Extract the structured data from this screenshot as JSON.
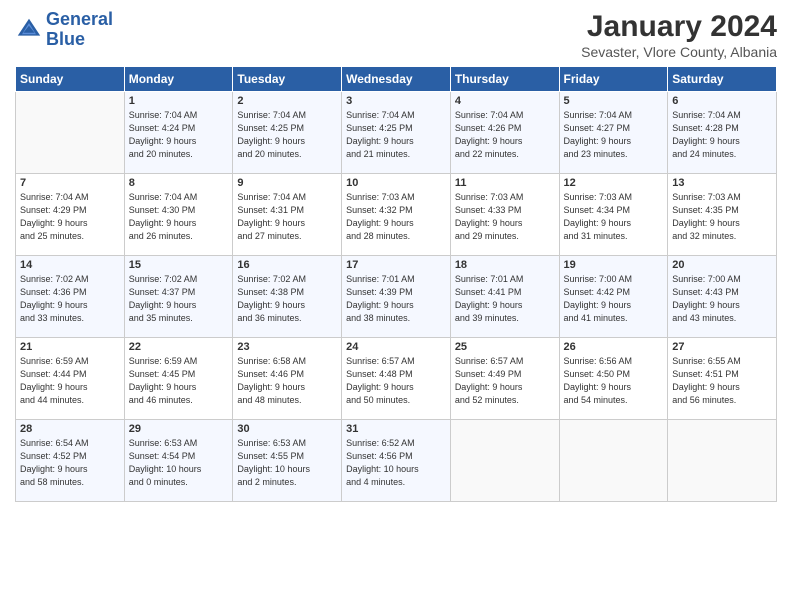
{
  "header": {
    "logo_line1": "General",
    "logo_line2": "Blue",
    "month": "January 2024",
    "location": "Sevaster, Vlore County, Albania"
  },
  "weekdays": [
    "Sunday",
    "Monday",
    "Tuesday",
    "Wednesday",
    "Thursday",
    "Friday",
    "Saturday"
  ],
  "weeks": [
    [
      {
        "day": "",
        "info": ""
      },
      {
        "day": "1",
        "info": "Sunrise: 7:04 AM\nSunset: 4:24 PM\nDaylight: 9 hours\nand 20 minutes."
      },
      {
        "day": "2",
        "info": "Sunrise: 7:04 AM\nSunset: 4:25 PM\nDaylight: 9 hours\nand 20 minutes."
      },
      {
        "day": "3",
        "info": "Sunrise: 7:04 AM\nSunset: 4:25 PM\nDaylight: 9 hours\nand 21 minutes."
      },
      {
        "day": "4",
        "info": "Sunrise: 7:04 AM\nSunset: 4:26 PM\nDaylight: 9 hours\nand 22 minutes."
      },
      {
        "day": "5",
        "info": "Sunrise: 7:04 AM\nSunset: 4:27 PM\nDaylight: 9 hours\nand 23 minutes."
      },
      {
        "day": "6",
        "info": "Sunrise: 7:04 AM\nSunset: 4:28 PM\nDaylight: 9 hours\nand 24 minutes."
      }
    ],
    [
      {
        "day": "7",
        "info": "Sunrise: 7:04 AM\nSunset: 4:29 PM\nDaylight: 9 hours\nand 25 minutes."
      },
      {
        "day": "8",
        "info": "Sunrise: 7:04 AM\nSunset: 4:30 PM\nDaylight: 9 hours\nand 26 minutes."
      },
      {
        "day": "9",
        "info": "Sunrise: 7:04 AM\nSunset: 4:31 PM\nDaylight: 9 hours\nand 27 minutes."
      },
      {
        "day": "10",
        "info": "Sunrise: 7:03 AM\nSunset: 4:32 PM\nDaylight: 9 hours\nand 28 minutes."
      },
      {
        "day": "11",
        "info": "Sunrise: 7:03 AM\nSunset: 4:33 PM\nDaylight: 9 hours\nand 29 minutes."
      },
      {
        "day": "12",
        "info": "Sunrise: 7:03 AM\nSunset: 4:34 PM\nDaylight: 9 hours\nand 31 minutes."
      },
      {
        "day": "13",
        "info": "Sunrise: 7:03 AM\nSunset: 4:35 PM\nDaylight: 9 hours\nand 32 minutes."
      }
    ],
    [
      {
        "day": "14",
        "info": "Sunrise: 7:02 AM\nSunset: 4:36 PM\nDaylight: 9 hours\nand 33 minutes."
      },
      {
        "day": "15",
        "info": "Sunrise: 7:02 AM\nSunset: 4:37 PM\nDaylight: 9 hours\nand 35 minutes."
      },
      {
        "day": "16",
        "info": "Sunrise: 7:02 AM\nSunset: 4:38 PM\nDaylight: 9 hours\nand 36 minutes."
      },
      {
        "day": "17",
        "info": "Sunrise: 7:01 AM\nSunset: 4:39 PM\nDaylight: 9 hours\nand 38 minutes."
      },
      {
        "day": "18",
        "info": "Sunrise: 7:01 AM\nSunset: 4:41 PM\nDaylight: 9 hours\nand 39 minutes."
      },
      {
        "day": "19",
        "info": "Sunrise: 7:00 AM\nSunset: 4:42 PM\nDaylight: 9 hours\nand 41 minutes."
      },
      {
        "day": "20",
        "info": "Sunrise: 7:00 AM\nSunset: 4:43 PM\nDaylight: 9 hours\nand 43 minutes."
      }
    ],
    [
      {
        "day": "21",
        "info": "Sunrise: 6:59 AM\nSunset: 4:44 PM\nDaylight: 9 hours\nand 44 minutes."
      },
      {
        "day": "22",
        "info": "Sunrise: 6:59 AM\nSunset: 4:45 PM\nDaylight: 9 hours\nand 46 minutes."
      },
      {
        "day": "23",
        "info": "Sunrise: 6:58 AM\nSunset: 4:46 PM\nDaylight: 9 hours\nand 48 minutes."
      },
      {
        "day": "24",
        "info": "Sunrise: 6:57 AM\nSunset: 4:48 PM\nDaylight: 9 hours\nand 50 minutes."
      },
      {
        "day": "25",
        "info": "Sunrise: 6:57 AM\nSunset: 4:49 PM\nDaylight: 9 hours\nand 52 minutes."
      },
      {
        "day": "26",
        "info": "Sunrise: 6:56 AM\nSunset: 4:50 PM\nDaylight: 9 hours\nand 54 minutes."
      },
      {
        "day": "27",
        "info": "Sunrise: 6:55 AM\nSunset: 4:51 PM\nDaylight: 9 hours\nand 56 minutes."
      }
    ],
    [
      {
        "day": "28",
        "info": "Sunrise: 6:54 AM\nSunset: 4:52 PM\nDaylight: 9 hours\nand 58 minutes."
      },
      {
        "day": "29",
        "info": "Sunrise: 6:53 AM\nSunset: 4:54 PM\nDaylight: 10 hours\nand 0 minutes."
      },
      {
        "day": "30",
        "info": "Sunrise: 6:53 AM\nSunset: 4:55 PM\nDaylight: 10 hours\nand 2 minutes."
      },
      {
        "day": "31",
        "info": "Sunrise: 6:52 AM\nSunset: 4:56 PM\nDaylight: 10 hours\nand 4 minutes."
      },
      {
        "day": "",
        "info": ""
      },
      {
        "day": "",
        "info": ""
      },
      {
        "day": "",
        "info": ""
      }
    ]
  ]
}
